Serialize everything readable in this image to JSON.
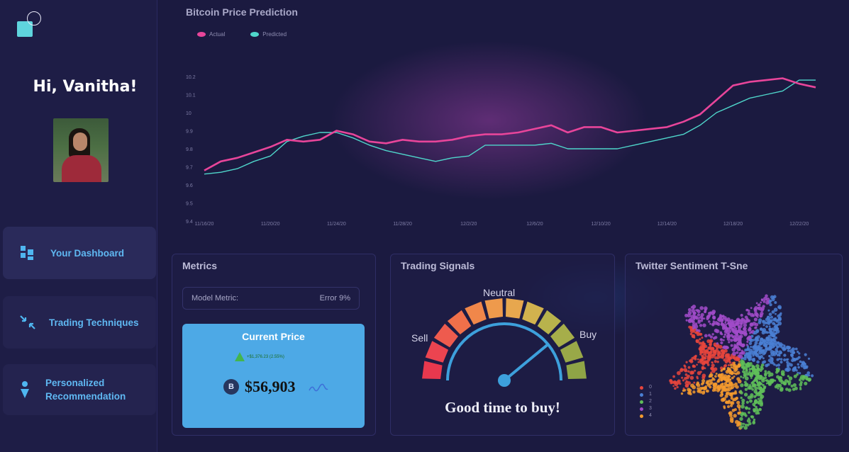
{
  "sidebar": {
    "greeting": "Hi, Vanitha!",
    "nav": [
      {
        "label": "Your Dashboard",
        "icon": "dashboard-grid-icon"
      },
      {
        "label": "Trading Techniques",
        "icon": "collapse-arrows-icon"
      },
      {
        "label_line1": "Personalized",
        "label_line2": "Recommendation",
        "icon": "location-pin-icon"
      }
    ]
  },
  "chart": {
    "title": "Bitcoin Price Prediction",
    "legend": [
      {
        "name": "Actual",
        "color": "#e8459a"
      },
      {
        "name": "Predicted",
        "color": "#4fd6cb"
      }
    ]
  },
  "chart_data": {
    "type": "line",
    "title": "Bitcoin Price Prediction",
    "x": [
      "11/16/20",
      "11/17/20",
      "11/18/20",
      "11/19/20",
      "11/20/20",
      "11/21/20",
      "11/22/20",
      "11/23/20",
      "11/24/20",
      "11/25/20",
      "11/26/20",
      "11/27/20",
      "11/28/20",
      "11/29/20",
      "11/30/20",
      "12/1/20",
      "12/2/20",
      "12/3/20",
      "12/4/20",
      "12/5/20",
      "12/6/20",
      "12/7/20",
      "12/8/20",
      "12/9/20",
      "12/10/20",
      "12/11/20",
      "12/12/20",
      "12/13/20",
      "12/14/20",
      "12/15/20",
      "12/16/20",
      "12/17/20",
      "12/18/20",
      "12/19/20",
      "12/20/20",
      "12/21/20",
      "12/22/20",
      "12/23/20"
    ],
    "xticks": [
      "11/16/20",
      "11/20/20",
      "11/24/20",
      "11/28/20",
      "12/2/20",
      "12/6/20",
      "12/10/20",
      "12/14/20",
      "12/18/20",
      "12/22/20"
    ],
    "yticks": [
      "9.4",
      "9.5",
      "9.6",
      "9.7",
      "9.8",
      "9.9",
      "10",
      "10.1",
      "10.2"
    ],
    "ylim": [
      9.4,
      10.2
    ],
    "series": [
      {
        "name": "Actual",
        "color": "#e8459a",
        "values": [
          9.68,
          9.73,
          9.75,
          9.78,
          9.81,
          9.85,
          9.84,
          9.85,
          9.9,
          9.88,
          9.84,
          9.83,
          9.85,
          9.84,
          9.84,
          9.85,
          9.87,
          9.88,
          9.88,
          9.89,
          9.91,
          9.93,
          9.89,
          9.92,
          9.92,
          9.89,
          9.9,
          9.91,
          9.92,
          9.95,
          9.99,
          10.07,
          10.15,
          10.17,
          10.18,
          10.19,
          10.16,
          10.14
        ]
      },
      {
        "name": "Predicted",
        "color": "#4fd6cb",
        "values": [
          9.66,
          9.67,
          9.69,
          9.73,
          9.76,
          9.84,
          9.87,
          9.89,
          9.89,
          9.86,
          9.82,
          9.79,
          9.77,
          9.75,
          9.73,
          9.75,
          9.76,
          9.82,
          9.82,
          9.82,
          9.82,
          9.83,
          9.8,
          9.8,
          9.8,
          9.8,
          9.82,
          9.84,
          9.86,
          9.88,
          9.93,
          10.0,
          10.04,
          10.08,
          10.1,
          10.12,
          10.18,
          10.18
        ]
      }
    ],
    "grid": false,
    "legend_position": "top-left"
  },
  "metrics": {
    "title": "Metrics",
    "model_metric_label": "Model Metric:",
    "model_metric_value": "Error 9%",
    "current_price_label": "Current Price",
    "change": "+$1,376.23 (2.55%)",
    "coin_symbol": "B",
    "price": "$56,903"
  },
  "signals": {
    "title": "Trading Signals",
    "sell": "Sell",
    "neutral": "Neutral",
    "buy": "Buy",
    "verdict": "Good time to buy!",
    "needle_level": 0.78
  },
  "sentiment": {
    "title": "Twitter Sentiment  T-Sne",
    "legend": [
      {
        "label": "0",
        "color": "#e8453c"
      },
      {
        "label": "1",
        "color": "#4a7fd4"
      },
      {
        "label": "2",
        "color": "#5fbe59"
      },
      {
        "label": "3",
        "color": "#a14bc9"
      },
      {
        "label": "4",
        "color": "#f39a2e"
      }
    ]
  }
}
